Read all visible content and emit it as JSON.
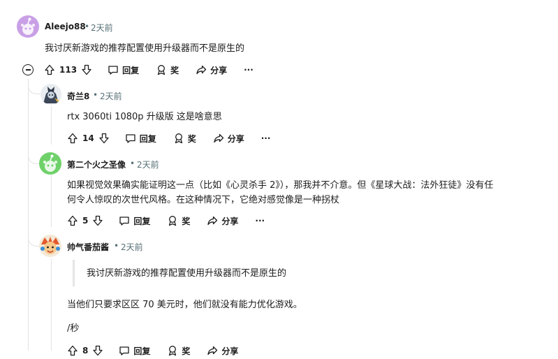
{
  "comments": [
    {
      "username": "Aleejo88",
      "time": "2天前",
      "body": "我讨厌新游戏的推荐配置使用升级器而不是原生的",
      "votes": "113",
      "reply": "回复",
      "award": "奖",
      "share": "分享",
      "more": "···"
    },
    {
      "username": "奇兰8",
      "time": "2天前",
      "body": "rtx 3060ti 1080p 升级版 这是啥意思",
      "votes": "14",
      "reply": "回复",
      "award": "奖",
      "share": "分享",
      "more": "···"
    },
    {
      "username": "第二个火之圣像",
      "time": "2天前",
      "body_line1": "如果视觉效果确实能证明这一点（比如《心灵杀手 2》），那我并不介意。但《星球大战：法外狂徒》没有任",
      "body_line2": "何令人惊叹的次世代风格。在这种情况下，它绝对感觉像是一种拐杖",
      "votes": "5",
      "reply": "回复",
      "award": "奖",
      "share": "分享",
      "more": "···"
    },
    {
      "username": "帅气番茄酱",
      "time": "2天前",
      "quote": "我讨厌新游戏的推荐配置使用升级器而不是原生的",
      "body": "当他们只要求区区 70 美元时，他们就没有能力优化游戏。",
      "signoff": "/秒",
      "votes": "8",
      "reply": "回复",
      "award": "奖",
      "share": "分享"
    }
  ],
  "separator": "•",
  "colors": {
    "text": "#1c1c1c",
    "meta": "#576f76",
    "thread_line": "#e3e3e3",
    "avatar_purple": "#c9a0e6",
    "avatar_green": "#6fd16a"
  },
  "icons": [
    "collapse-icon",
    "upvote-icon",
    "downvote-icon",
    "comment-icon",
    "award-icon",
    "share-icon",
    "more-icon"
  ]
}
